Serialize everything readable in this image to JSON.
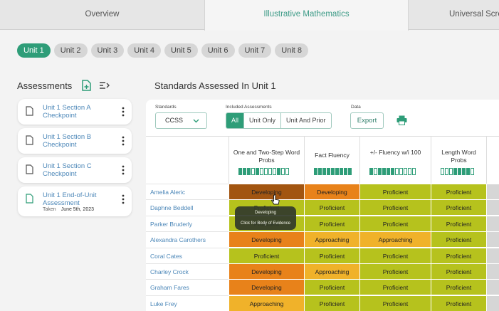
{
  "tabs": [
    "Overview",
    "Illustrative Mathematics",
    "Universal Scree"
  ],
  "units": [
    "Unit 1",
    "Unit 2",
    "Unit 3",
    "Unit 4",
    "Unit 5",
    "Unit 6",
    "Unit 7",
    "Unit 8"
  ],
  "active_unit": "Unit 1",
  "sidebar": {
    "title": "Assessments",
    "items": [
      {
        "name": "Unit 1 Section A Checkpoint"
      },
      {
        "name": "Unit 1 Section B Checkpoint"
      },
      {
        "name": "Unit 1 Section C Checkpoint"
      },
      {
        "name": "Unit 1 End-of-Unit Assessment",
        "taken_label": "Taken",
        "taken_date": "June 5th, 2023"
      }
    ]
  },
  "main": {
    "title": "Standards Assessed In Unit 1",
    "standards_label": "Standards",
    "standards_value": "CCSS",
    "included_label": "Included Assessments",
    "included_options": [
      "All",
      "Unit Only",
      "Unit And Prior"
    ],
    "included_selected": "All",
    "data_label": "Data",
    "export_label": "Export"
  },
  "columns": [
    {
      "title": "One and Two-Step Word Probs",
      "fill": [
        1,
        1,
        1,
        0,
        1,
        0,
        0,
        0,
        0,
        1,
        0,
        0
      ]
    },
    {
      "title": "Fact Fluency",
      "fill": [
        1,
        1,
        1,
        1,
        1,
        1,
        1,
        1,
        1
      ]
    },
    {
      "title": "+/- Fluency w/i 100",
      "fill": [
        1,
        0,
        1,
        1,
        1,
        1,
        0,
        0,
        0,
        0,
        0
      ]
    },
    {
      "title": "Length Word Probs",
      "fill": [
        0,
        0,
        0,
        1,
        1,
        1,
        1,
        0
      ]
    }
  ],
  "rows": [
    {
      "student": "Amelia Aleric",
      "levels": [
        "Developing",
        "Developing",
        "Proficient",
        "Proficient",
        ""
      ]
    },
    {
      "student": "Daphne Beddell",
      "levels": [
        "Proficient",
        "Proficient",
        "Proficient",
        "Proficient",
        ""
      ]
    },
    {
      "student": "Parker Bruderly",
      "levels": [
        "Proficient",
        "Proficient",
        "Proficient",
        "Proficient",
        ""
      ]
    },
    {
      "student": "Alexandra Carothers",
      "levels": [
        "Developing",
        "Approaching",
        "Approaching",
        "Proficient",
        ""
      ]
    },
    {
      "student": "Coral Cates",
      "levels": [
        "Proficient",
        "Proficient",
        "Proficient",
        "Proficient",
        ""
      ]
    },
    {
      "student": "Charley Crock",
      "levels": [
        "Developing",
        "Approaching",
        "Proficient",
        "Proficient",
        ""
      ]
    },
    {
      "student": "Graham Fares",
      "levels": [
        "Developing",
        "Proficient",
        "Proficient",
        "Proficient",
        ""
      ]
    },
    {
      "student": "Luke Frey",
      "levels": [
        "Approaching",
        "Proficient",
        "Proficient",
        "Proficient",
        ""
      ]
    }
  ],
  "tooltip": {
    "level": "Developing",
    "hint": "Click for Body of Evidence"
  },
  "colors": {
    "accent": "#2e9d78",
    "developing": "#e8821a",
    "developing_hover": "#a25511",
    "approaching": "#f0b22a",
    "proficient": "#b6c21d",
    "link": "#4c87b8"
  }
}
